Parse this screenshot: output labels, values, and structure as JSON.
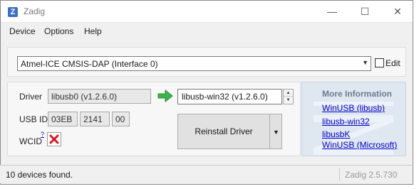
{
  "window": {
    "title": "Zadig",
    "icon_letter": "Z",
    "min_glyph": "—",
    "max_glyph": "☐",
    "close_glyph": "✕"
  },
  "menu": {
    "items": [
      "Device",
      "Options",
      "Help"
    ]
  },
  "device": {
    "selected": "Atmel-ICE CMSIS-DAP (Interface 0)",
    "edit_label": "Edit",
    "edit_checked": false
  },
  "driver": {
    "label": "Driver",
    "current": "libusb0 (v1.2.6.0)",
    "target": "libusb-win32 (v1.2.6.0)",
    "install_label": "Reinstall Driver",
    "arrow_color": "#3cb64a"
  },
  "usbid": {
    "label": "USB ID",
    "vid": "03EB",
    "pid": "2141",
    "mi": "00"
  },
  "wcid": {
    "label": "WCID",
    "help_mark": "?",
    "status_color": "#e0141e"
  },
  "info": {
    "title": "More Information",
    "links": [
      "WinUSB (libusb)",
      "libusb-win32",
      "libusbK",
      "WinUSB (Microsoft)"
    ]
  },
  "status": {
    "text": "10 devices found.",
    "version": "Zadig 2.5.730"
  }
}
